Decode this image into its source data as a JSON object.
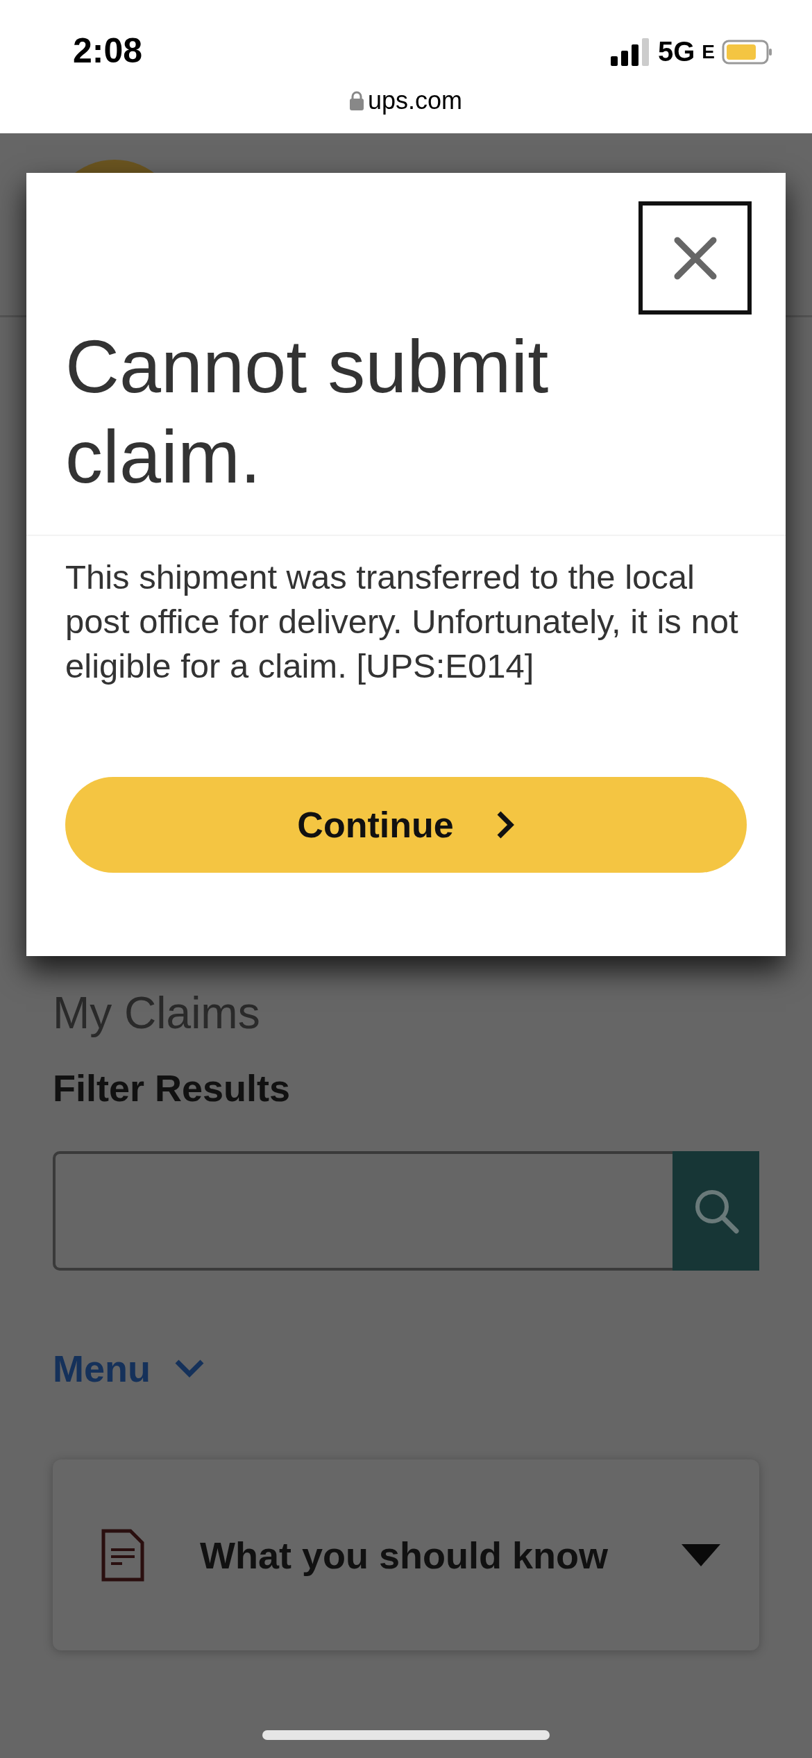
{
  "status_bar": {
    "time": "2:08",
    "network": "5G",
    "network_suffix": "E"
  },
  "address_bar": {
    "url": "ups.com"
  },
  "page": {
    "heading": "My Claims",
    "filter_label": "Filter Results",
    "menu": {
      "label": "Menu",
      "expanded": false
    },
    "accordion": {
      "title": "What you should know",
      "expanded": false
    }
  },
  "dialog": {
    "title": "Cannot submit claim.",
    "message": "This shipment was transferred to the local post office for delivery. Unfortunately, it is not eligible for a claim. [UPS:E014]",
    "button": "Continue"
  }
}
